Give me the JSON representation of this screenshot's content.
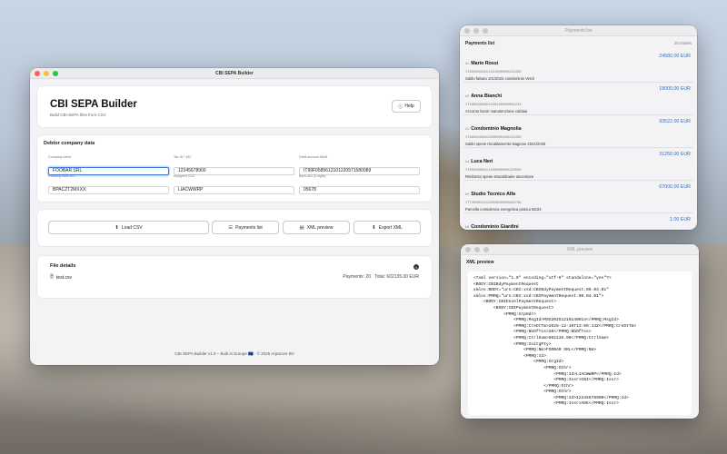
{
  "main_window": {
    "title": "CBI SEPA Builder",
    "header": {
      "title": "CBI SEPA Builder",
      "subtitle": "Build CBI-SEPA files from CSV",
      "help_label": "Help"
    },
    "debtor": {
      "section_title": "Debtor company data",
      "fields": [
        {
          "label": "Company name",
          "value": "FOOBAR SRL"
        },
        {
          "label": "Tax ID / VAT",
          "value": "12345678900"
        },
        {
          "label": "Debit account IBAN",
          "value": "IT99F0585612101220571580089"
        },
        {
          "label": "Ordering bank BIC",
          "value": "BPACZT2MXXX"
        },
        {
          "label": "Assigned CUC",
          "value": "LIACWWRP"
        },
        {
          "label": "Bank ABI (5 digits)",
          "value": "05678"
        }
      ]
    },
    "actions": {
      "load_csv": "Load CSV",
      "payments_list": "Payments list",
      "xml_preview": "XML preview",
      "export_xml": "Export XML"
    },
    "file_details": {
      "title": "File details",
      "file_name": "test.csv",
      "stats": "Payments: 20   Total: 602135.00 EUR"
    },
    "footer": "CBI SEPA Builder v1.0 – Built in Europe 🇪🇺 · © 2025 Arpacore BV"
  },
  "payments_window": {
    "title": "Payments list",
    "heading": "Payments list",
    "count": "20 entries",
    "items": [
      {
        "num": "#1",
        "name": "Mario Rossi",
        "amount": "24580.00 EUR",
        "iban": "IT60X0542811101000000123456",
        "desc": "Saldo fattura 101/2024 condominio Verdi"
      },
      {
        "num": "#2",
        "name": "Anna Bianchi",
        "amount": "18000.00 EUR",
        "iban": "IT16N0306901230100000001234",
        "desc": "Acconto lavori manutenzione caldaia"
      },
      {
        "num": "#3",
        "name": "Condominio Magnolia",
        "amount": "93522.00 EUR",
        "iban": "IT98X0200812300000100123456",
        "desc": "Saldo spese riscaldamento stagione 2024/2025"
      },
      {
        "num": "#4",
        "name": "Luca Neri",
        "amount": "31250.00 EUR",
        "iban": "IT85K0306911100000000123000",
        "desc": "Rimborso spese straordinarie ascensore"
      },
      {
        "num": "#5",
        "name": "Studio Tecnico Alfa",
        "amount": "67000.00 EUR",
        "iban": "IT72K0622512304000000456789",
        "desc": "Parcella consulenza energetica pratica 55/24"
      },
      {
        "num": "#6",
        "name": "Condominio Giardini",
        "amount": "1.00 EUR",
        "iban": "",
        "desc": ""
      }
    ]
  },
  "xml_window": {
    "title": "XML preview",
    "heading": "XML preview",
    "lines": [
      "<?xml version=\"1.0\" encoding=\"utf-8\" standalone=\"yes\"?>",
      "<BODY:CBIBdyPaymentRequest",
      "xmlns:BODY=\"urn:CBI:xsd:CBIBdyPaymentRequest.00.04.01\"",
      "xmlns:PMRQ=\"urn:CBI:xsd:CBIPaymentRequest.00.04.01\">",
      "    <BODY:CBIEnvelPaymentRequest>",
      "        <BODY:CBIPaymentRequest>",
      "            <PMRQ:GrpHdr>",
      "                <PMRQ:MsgId>MSG20251210140914</PMRQ:MsgId>",
      "                <PMRQ:CreDtTm>2025-12-10T13:09:14Z</PMRQ:CreDtTm>",
      "                <PMRQ:NbOfTxs>20</PMRQ:NbOfTxs>",
      "                <PMRQ:CtrlSum>602135.00</PMRQ:CtrlSum>",
      "                <PMRQ:InitgPty>",
      "                    <PMRQ:Nm>FOOBAR SRL</PMRQ:Nm>",
      "                    <PMRQ:Id>",
      "                        <PMRQ:OrgId>",
      "                            <PMRQ:Othr>",
      "                                <PMRQ:Id>LIACWWRP</PMRQ:Id>",
      "                                <PMRQ:Issr>CBI</PMRQ:Issr>",
      "                            </PMRQ:Othr>",
      "                            <PMRQ:Othr>",
      "                                <PMRQ:Id>12345678900</PMRQ:Id>",
      "                                <PMRQ:Issr>ADE</PMRQ:Issr>"
    ]
  }
}
